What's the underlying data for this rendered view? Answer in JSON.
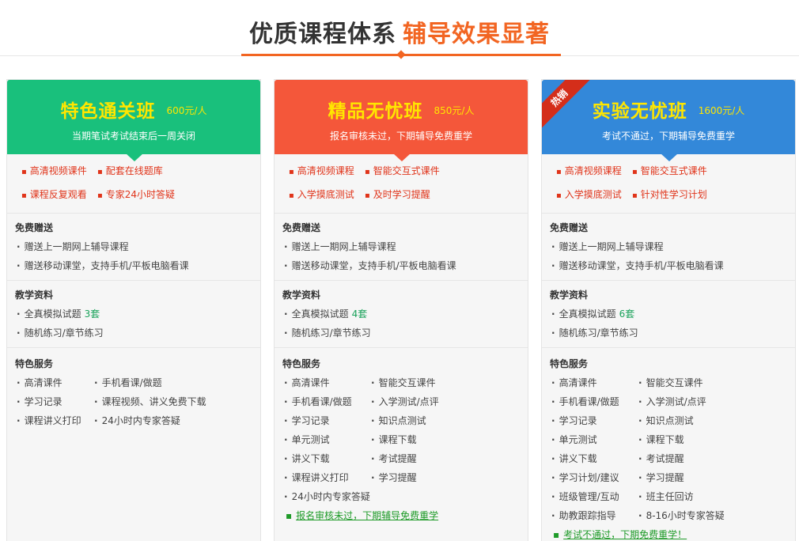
{
  "header": {
    "title_dark": "优质课程体系",
    "title_accent": "辅导效果显著"
  },
  "colors": {
    "accent": "#f26522",
    "card1": "#19c07c",
    "card2": "#f4573a",
    "card3": "#3388d9",
    "title_yellow": "#ffe600",
    "feature_red": "#e0341a",
    "link_green": "#1f9b29"
  },
  "cards": [
    {
      "title": "特色通关班",
      "price": "600元/人",
      "subtitle": "当期笔试考试结束后一周关闭",
      "features": [
        "高清视频课件",
        "配套在线题库",
        "课程反复观看",
        "专家24小时答疑"
      ],
      "gift_title": "免费赠送",
      "gifts": [
        "赠送上一期网上辅导课程",
        "赠送移动课堂，支持手机/平板电脑看课"
      ],
      "material_title": "教学资料",
      "materials": [
        {
          "label": "全真模拟试题",
          "count": "3套"
        },
        {
          "label": "随机练习/章节练习",
          "count": ""
        }
      ],
      "service_title": "特色服务",
      "services": [
        "高清课件",
        "手机看课/做题",
        "学习记录",
        "课程视频、讲义免费下载",
        "课程讲义打印",
        "24小时内专家答疑"
      ]
    },
    {
      "title": "精品无忧班",
      "price": "850元/人",
      "subtitle": "报名审核未过，下期辅导免费重学",
      "features": [
        "高清视频课程",
        "智能交互式课件",
        "入学摸底测试",
        "及时学习提醒"
      ],
      "gift_title": "免费赠送",
      "gifts": [
        "赠送上一期网上辅导课程",
        "赠送移动课堂，支持手机/平板电脑看课"
      ],
      "material_title": "教学资料",
      "materials": [
        {
          "label": "全真模拟试题",
          "count": "4套"
        },
        {
          "label": "随机练习/章节练习",
          "count": ""
        }
      ],
      "service_title": "特色服务",
      "services": [
        "高清课件",
        "智能交互课件",
        "手机看课/做题",
        "入学测试/点评",
        "学习记录",
        "知识点测试",
        "单元测试",
        "课程下载",
        "讲义下载",
        "考试提醒",
        "课程讲义打印",
        "学习提醒",
        "24小时内专家答疑"
      ],
      "bottom_link": "报名审核未过，下期辅导免费重学"
    },
    {
      "title": "实验无忧班",
      "price": "1600元/人",
      "subtitle": "考试不通过，下期辅导免费重学",
      "hot_badge": "热销",
      "features": [
        "高清视频课程",
        "智能交互式课件",
        "入学摸底测试",
        "针对性学习计划"
      ],
      "gift_title": "免费赠送",
      "gifts": [
        "赠送上一期网上辅导课程",
        "赠送移动课堂，支持手机/平板电脑看课"
      ],
      "material_title": "教学资料",
      "materials": [
        {
          "label": "全真模拟试题",
          "count": "6套"
        },
        {
          "label": "随机练习/章节练习",
          "count": ""
        }
      ],
      "service_title": "特色服务",
      "services": [
        "高清课件",
        "智能交互课件",
        "手机看课/做题",
        "入学测试/点评",
        "学习记录",
        "知识点测试",
        "单元测试",
        "课程下载",
        "讲义下载",
        "考试提醒",
        "学习计划/建议",
        "学习提醒",
        "班级管理/互动",
        "班主任回访",
        "助教跟踪指导",
        "8-16小时专家答疑"
      ],
      "bottom_link": "考试不通过，下期免费重学！"
    }
  ]
}
